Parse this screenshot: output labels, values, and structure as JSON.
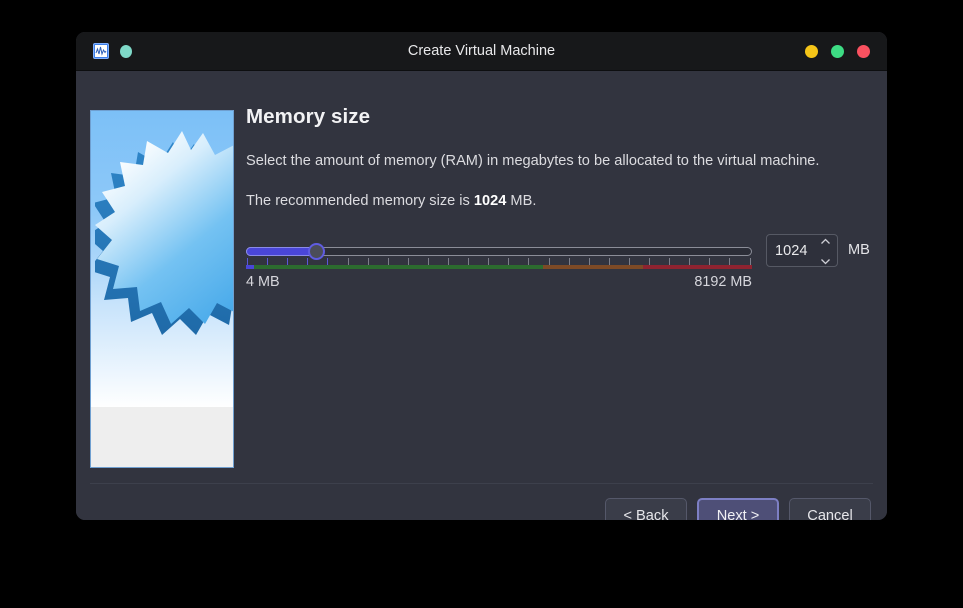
{
  "window": {
    "title": "Create Virtual Machine",
    "app_icon": "vm-app-icon",
    "status_dot": "status-dot-icon",
    "controls": [
      {
        "name": "minimize-button",
        "color": "#f5c518"
      },
      {
        "name": "maximize-button",
        "color": "#3ddc84"
      },
      {
        "name": "close-button",
        "color": "#fa5160"
      }
    ]
  },
  "sidebar": {
    "graphic_name": "wizard-starburst-graphic"
  },
  "main": {
    "title": "Memory size",
    "description": "Select the amount of memory (RAM) in megabytes to be allocated to the virtual machine.",
    "recommend_prefix": "The recommended memory size is ",
    "recommend_value": "1024",
    "recommend_suffix": " MB.",
    "slider": {
      "name": "memory-size-slider",
      "value": 1024,
      "min": 4,
      "max": 8192,
      "min_label": "4 MB",
      "max_label": "8192 MB",
      "fill_color": "#4a46d8",
      "handle_color": "#5f5ce0",
      "scale_colors": {
        "low": "#4a46d8",
        "ok": "#2c6b2f",
        "warn": "#7d4a26",
        "danger": "#8e2330"
      }
    },
    "spinbox": {
      "name": "memory-size-spinbox",
      "value": "1024",
      "unit": "MB",
      "up_icon": "chevron-up-icon",
      "down_icon": "chevron-down-icon"
    }
  },
  "footer": {
    "back_label": "< Back",
    "next_label": "Next >",
    "cancel_label": "Cancel"
  }
}
